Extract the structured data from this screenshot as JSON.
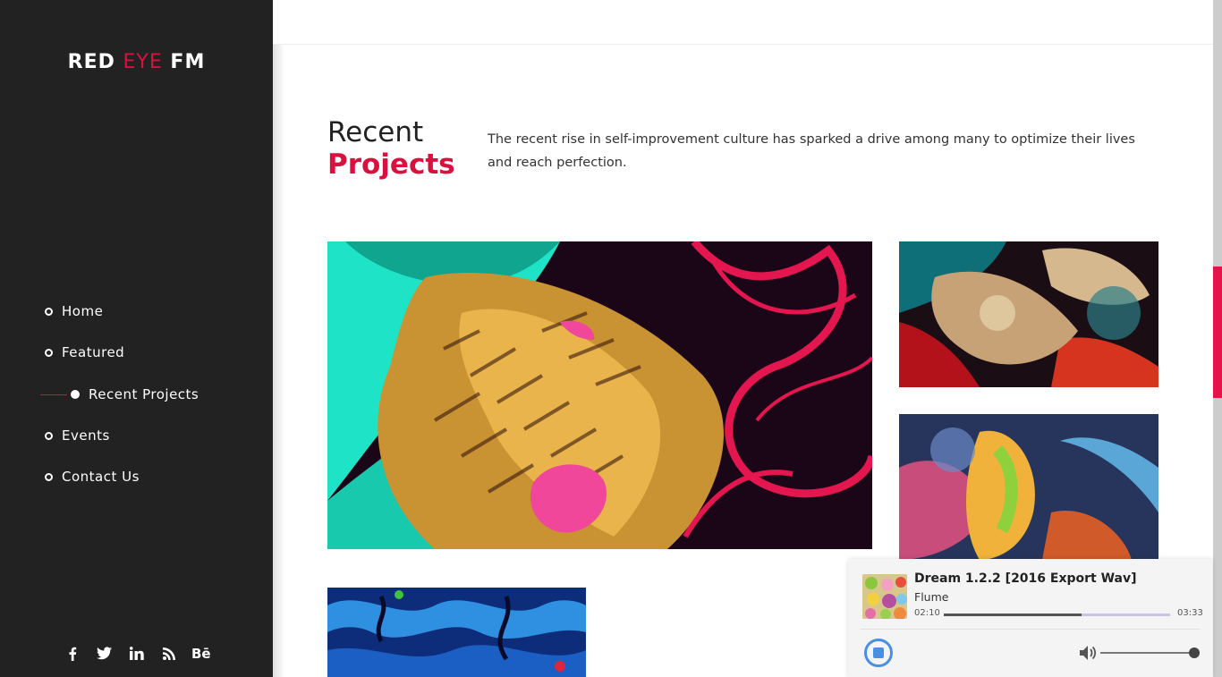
{
  "brand": {
    "part1": "RED ",
    "part2": "EYE",
    "part3": " FM"
  },
  "nav": {
    "items": [
      {
        "label": "Home",
        "active": false
      },
      {
        "label": "Featured",
        "active": false
      },
      {
        "label": "Recent Projects",
        "active": true
      },
      {
        "label": "Events",
        "active": false
      },
      {
        "label": "Contact Us",
        "active": false
      }
    ]
  },
  "social": {
    "icons": [
      "facebook-icon",
      "twitter-icon",
      "linkedin-icon",
      "rss-icon",
      "behance-icon"
    ],
    "glyphs": [
      "f",
      "🐦",
      "in",
      "◝",
      "Bē"
    ]
  },
  "section": {
    "title_line1": "Recent",
    "title_line2": "Projects",
    "description": "The recent rise in self-improvement culture has sparked a drive among many to optimize their lives and reach perfection."
  },
  "player": {
    "title": "Dream 1.2.2 [2016 Export Wav]",
    "artist": "Flume",
    "current_time": "02:10",
    "total_time": "03:33",
    "progress": 0.61,
    "volume": 1.0
  },
  "colors": {
    "accent": "#d9113f",
    "sidebar": "#222222",
    "player_accent": "#4a90e2"
  }
}
